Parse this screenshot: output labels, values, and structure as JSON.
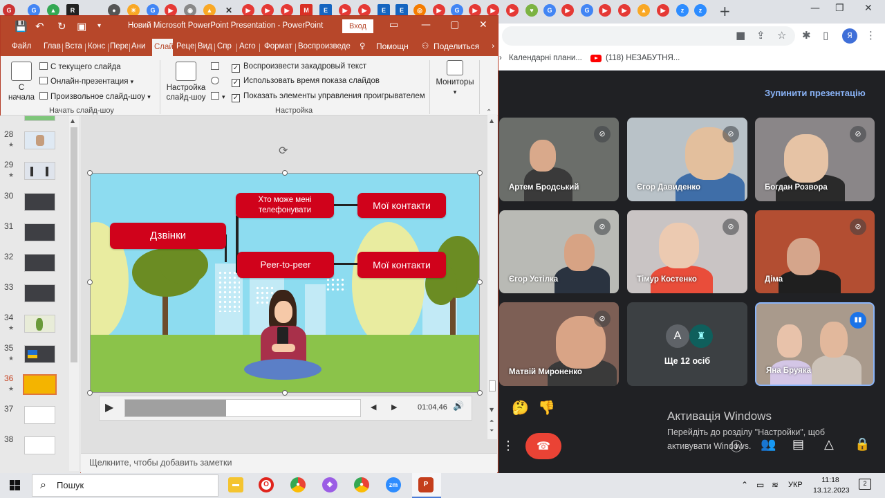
{
  "chrome": {
    "bookmark_1": "Календарні плани...",
    "bookmark_2": "(118) НЕЗАБУТНЯ...",
    "profile_letter": "Я"
  },
  "meet": {
    "stop_presentation": "Зупинити презентацію",
    "participants": [
      {
        "name": "Артем Бродський"
      },
      {
        "name": "Єгор Давиденко"
      },
      {
        "name": "Богдан Розвора"
      },
      {
        "name": "Єгор Устілка"
      },
      {
        "name": "Тімур Костенко"
      },
      {
        "name": "Діма"
      },
      {
        "name": "Матвій Мироненко"
      },
      {
        "name": "Яна Бруяка"
      }
    ],
    "more_avatar_letter": "A",
    "more_people": "Ще 12 осіб"
  },
  "windows_activation": {
    "title": "Активація Windows",
    "text": "Перейдіть до розділу \"Настройки\", щоб активувати Windows."
  },
  "ppt": {
    "window_title": "Новий Microsoft PowerPoint Presentation  -  PowerPoint",
    "signin": "Вход",
    "tabs": [
      "Файл",
      "Глав",
      "Вста",
      "Конс",
      "Пере",
      "Ани",
      "Слай",
      "Реце",
      "Вид",
      "Спр",
      "Acro",
      "Формат",
      "Воспроизведе",
      "Помощн",
      "Поделиться"
    ],
    "ribbon": {
      "from_start_1": "С",
      "from_start_2": "начала",
      "from_current": "С текущего слайда",
      "online": "Онлайн-презентация",
      "custom": "Произвольное слайд-шоу",
      "group_start": "Начать слайд-шоу",
      "setup_1": "Настройка",
      "setup_2": "слайд-шоу",
      "play_narrations": "Воспроизвести закадровый текст",
      "use_timings": "Использовать время показа слайдов",
      "show_controls": "Показать элементы управления проигрывателем",
      "group_setup": "Настройка",
      "monitors": "Мониторы"
    },
    "slides": [
      {
        "num": "28",
        "star": "★"
      },
      {
        "num": "29",
        "star": "★"
      },
      {
        "num": "30",
        "star": ""
      },
      {
        "num": "31",
        "star": ""
      },
      {
        "num": "32",
        "star": ""
      },
      {
        "num": "33",
        "star": ""
      },
      {
        "num": "34",
        "star": "★"
      },
      {
        "num": "35",
        "star": "★"
      },
      {
        "num": "36",
        "star": "★"
      },
      {
        "num": "37",
        "star": ""
      },
      {
        "num": "38",
        "star": ""
      }
    ],
    "slide_content": {
      "calls": "Дзвінки",
      "who_can_call": "Хто може мені телефонувати",
      "my_contacts_1": "Мої контакти",
      "peer": "Peer-to-peer",
      "my_contacts_2": "Мої контакти"
    },
    "player": {
      "time": "01:04,46",
      "progress": 0.43
    },
    "notes_placeholder": "Щелкните, чтобы добавить заметки"
  },
  "taskbar": {
    "search": "Пошук",
    "lang": "УКР",
    "time": "11:18",
    "date": "13.12.2023",
    "notifications": "2"
  }
}
